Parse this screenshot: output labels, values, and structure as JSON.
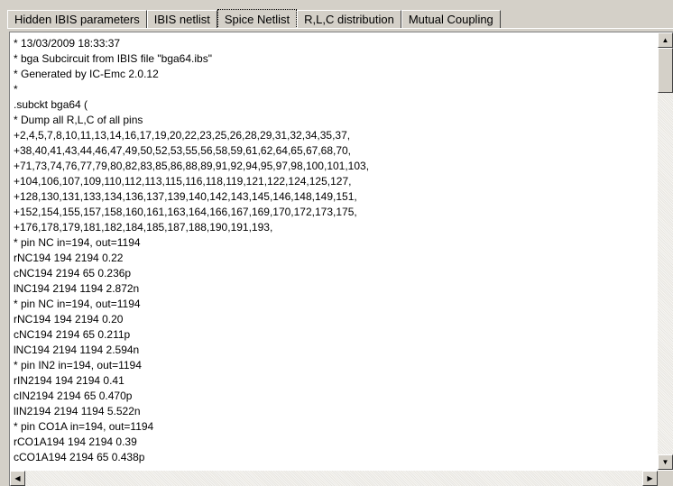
{
  "tabs": [
    {
      "label": "Hidden IBIS parameters",
      "active": false
    },
    {
      "label": "IBIS netlist",
      "active": false
    },
    {
      "label": "Spice Netlist",
      "active": true
    },
    {
      "label": "R,L,C distribution",
      "active": false
    },
    {
      "label": "Mutual Coupling",
      "active": false
    }
  ],
  "netlist_lines": [
    "* 13/03/2009 18:33:37",
    "* bga Subcircuit from IBIS file \"bga64.ibs\"",
    "* Generated by IC-Emc 2.0.12",
    "*",
    ".subckt bga64 (",
    "* Dump all R,L,C of all pins",
    "+2,4,5,7,8,10,11,13,14,16,17,19,20,22,23,25,26,28,29,31,32,34,35,37,",
    "+38,40,41,43,44,46,47,49,50,52,53,55,56,58,59,61,62,64,65,67,68,70,",
    "+71,73,74,76,77,79,80,82,83,85,86,88,89,91,92,94,95,97,98,100,101,103,",
    "+104,106,107,109,110,112,113,115,116,118,119,121,122,124,125,127,",
    "+128,130,131,133,134,136,137,139,140,142,143,145,146,148,149,151,",
    "+152,154,155,157,158,160,161,163,164,166,167,169,170,172,173,175,",
    "+176,178,179,181,182,184,185,187,188,190,191,193,",
    "* pin NC in=194, out=1194",
    "rNC194 194 2194 0.22",
    "cNC194 2194 65 0.236p",
    "lNC194 2194 1194 2.872n",
    "* pin NC in=194, out=1194",
    "rNC194 194 2194 0.20",
    "cNC194 2194 65 0.211p",
    "lNC194 2194 1194 2.594n",
    "* pin IN2 in=194, out=1194",
    "rIN2194 194 2194 0.41",
    "cIN2194 2194 65 0.470p",
    "lIN2194 2194 1194 5.522n",
    "* pin CO1A in=194, out=1194",
    "rCO1A194 194 2194 0.39",
    "cCO1A194 2194 65 0.438p"
  ],
  "icons": {
    "scroll_up": "arrow-up-icon",
    "scroll_down": "arrow-down-icon",
    "scroll_left": "arrow-left-icon",
    "scroll_right": "arrow-right-icon"
  }
}
